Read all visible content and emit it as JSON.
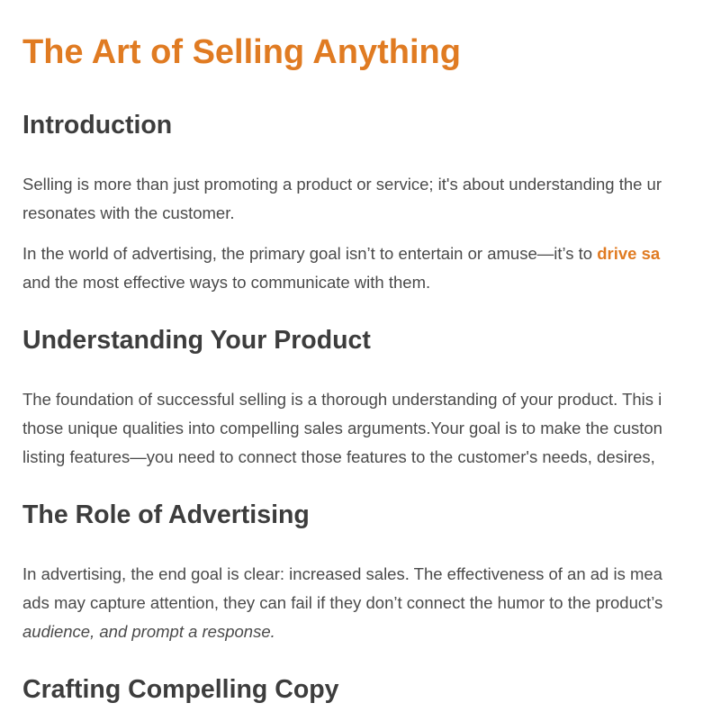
{
  "title": "The Art of Selling Anything",
  "sections": {
    "intro": {
      "heading": "Introduction",
      "p1_line1": "Selling is more than just promoting a product or service; it's about understanding the ur",
      "p1_line2": "resonates with the customer.",
      "p2_line1_before": "In the world of advertising, the primary goal isn’t to entertain or amuse—it’s to ",
      "p2_line1_highlight": "drive sa",
      "p2_line2": "and the most effective ways to communicate with them."
    },
    "product": {
      "heading": "Understanding Your Product",
      "line1": "The foundation of successful selling is a thorough understanding of your product. This i",
      "line2": "those unique qualities into compelling sales arguments.Your goal is to make the custon",
      "line3": "listing features—you need to connect those features to the customer's needs, desires,"
    },
    "advertising": {
      "heading": "The Role of Advertising",
      "line1": "In advertising, the end goal is clear: increased sales. The effectiveness of an ad is mea",
      "line2": "ads may capture attention, they can fail if they don’t connect the humor to the product’s",
      "line3": "audience, and prompt a response."
    },
    "copy": {
      "heading": "Crafting Compelling Copy"
    }
  },
  "colors": {
    "accent": "#e07b22",
    "heading": "#3d3d3d",
    "body": "#4a4a4a"
  }
}
